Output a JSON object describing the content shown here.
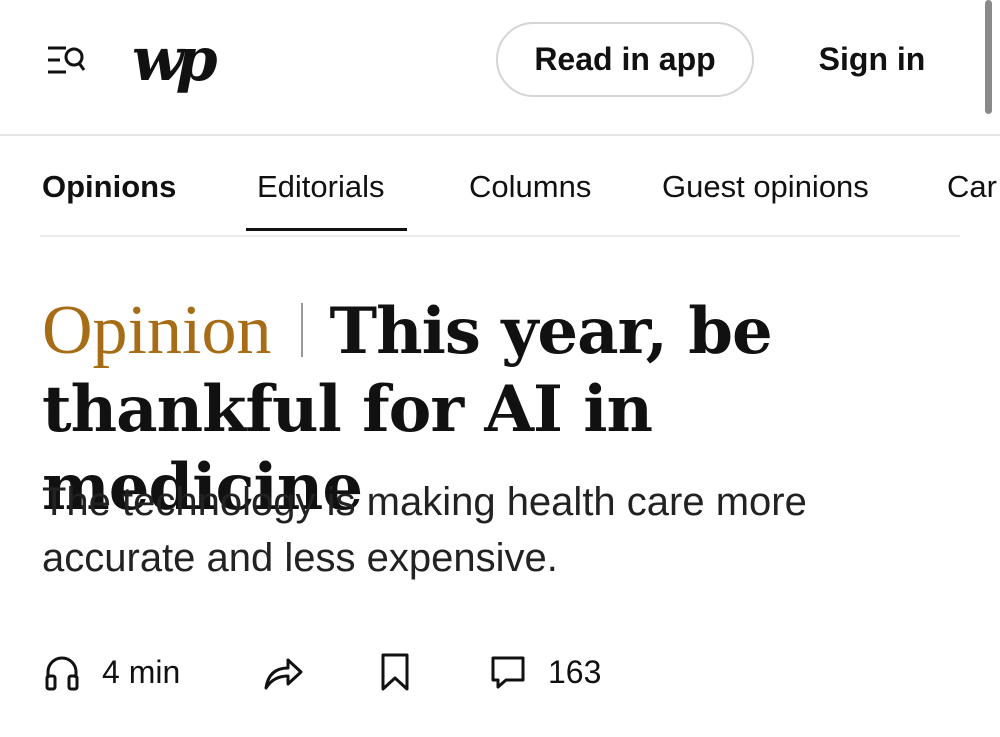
{
  "header": {
    "logo_text": "wp",
    "read_in_app_label": "Read in app",
    "sign_in_label": "Sign in",
    "menu_icon": "menu-search-icon"
  },
  "nav": {
    "items": [
      {
        "label": "Opinions",
        "active": true
      },
      {
        "label": "Editorials",
        "selected": true
      },
      {
        "label": "Columns"
      },
      {
        "label": "Guest opinions"
      },
      {
        "label": "Car"
      }
    ]
  },
  "article": {
    "kicker": "Opinion",
    "headline": "This year, be thankful for AI in medicine",
    "dek": "The technology is making health care more accurate and less expensive.",
    "kicker_color": "#a66c16"
  },
  "toolbar": {
    "listen_label": "4 min",
    "listen_icon": "headphones-icon",
    "share_icon": "share-icon",
    "save_icon": "bookmark-icon",
    "comments_icon": "comment-icon",
    "comments_count": "163"
  }
}
